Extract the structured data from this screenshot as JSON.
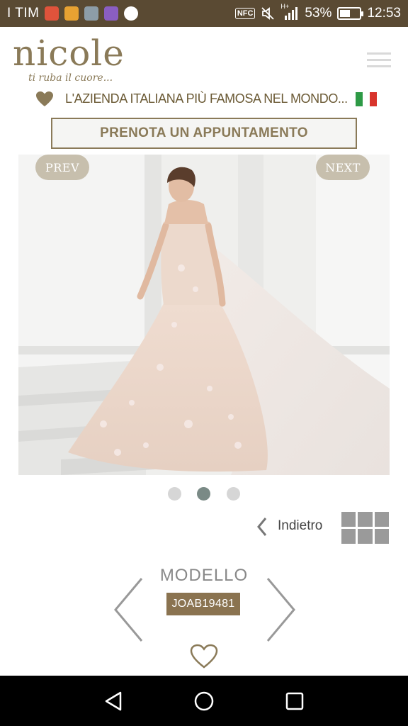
{
  "status_bar": {
    "carrier": "I TIM",
    "nfc": "NFC",
    "network": "H+",
    "battery": "53%",
    "battery_level": 0.53,
    "time": "12:53"
  },
  "header": {
    "logo": "nicole",
    "tagline": "ti ruba il cuore...",
    "slogan": "L'AZIENDA ITALIANA PIÙ FAMOSA NEL MONDO...",
    "flag_colors": [
      "#2e9a46",
      "#ffffff",
      "#d8342c"
    ]
  },
  "cta": {
    "label": "PRENOTA UN APPUNTAMENTO"
  },
  "gallery": {
    "prev": "PREV",
    "next": "NEXT",
    "dot_count": 3,
    "active_dot": 2
  },
  "navigation": {
    "back_label": "Indietro"
  },
  "model": {
    "label": "MODELLO",
    "code": "JOAB19481"
  },
  "icons": {
    "heart": "heart-icon",
    "grid": "grid-icon",
    "menu": "menu-icon",
    "back": "chevron-left-icon"
  },
  "colors": {
    "brand": "#8a7a58",
    "status_bar": "#5a4a33",
    "model_code_bg": "#8a7350",
    "active_dot": "#7a8a86"
  }
}
